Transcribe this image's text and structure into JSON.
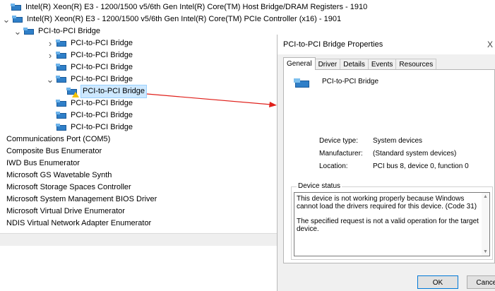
{
  "tree": {
    "items": [
      {
        "label": "Intel(R) Xeon(R) E3 - 1200/1500 v5/6th Gen Intel(R) Core(TM) Host Bridge/DRAM Registers - 1910",
        "indent": 0,
        "chevron": "none",
        "icon": "device"
      },
      {
        "label": "Intel(R) Xeon(R) E3 - 1200/1500 v5/6th Gen Intel(R) Core(TM) PCIe Controller (x16) - 1901",
        "indent": 0,
        "chevron": "down",
        "icon": "device"
      },
      {
        "label": "PCI-to-PCI Bridge",
        "indent": 1,
        "chevron": "down",
        "icon": "device"
      },
      {
        "label": "PCI-to-PCI Bridge",
        "indent": 2,
        "chevron": "right",
        "icon": "device"
      },
      {
        "label": "PCI-to-PCI Bridge",
        "indent": 2,
        "chevron": "right",
        "icon": "device"
      },
      {
        "label": "PCI-to-PCI Bridge",
        "indent": 2,
        "chevron": "none",
        "icon": "device"
      },
      {
        "label": "PCI-to-PCI Bridge",
        "indent": 2,
        "chevron": "down",
        "icon": "device"
      },
      {
        "label": "PCI-to-PCI Bridge",
        "indent": 3,
        "chevron": "none",
        "icon": "warning-device",
        "selected": true
      },
      {
        "label": "PCI-to-PCI Bridge",
        "indent": 2,
        "chevron": "none",
        "icon": "device"
      },
      {
        "label": "PCI-to-PCI Bridge",
        "indent": 2,
        "chevron": "none",
        "icon": "device"
      },
      {
        "label": "PCI-to-PCI Bridge",
        "indent": 2,
        "chevron": "none",
        "icon": "device"
      },
      {
        "label": "Communications Port (COM5)",
        "indent": -1,
        "chevron": "none",
        "icon": "none"
      },
      {
        "label": "Composite Bus Enumerator",
        "indent": -1,
        "chevron": "none",
        "icon": "none"
      },
      {
        "label": "IWD Bus Enumerator",
        "indent": -1,
        "chevron": "none",
        "icon": "none"
      },
      {
        "label": "Microsoft GS Wavetable Synth",
        "indent": -1,
        "chevron": "none",
        "icon": "none"
      },
      {
        "label": "Microsoft Storage Spaces Controller",
        "indent": -1,
        "chevron": "none",
        "icon": "none"
      },
      {
        "label": "Microsoft System Management BIOS Driver",
        "indent": -1,
        "chevron": "none",
        "icon": "none"
      },
      {
        "label": "Microsoft Virtual Drive Enumerator",
        "indent": -1,
        "chevron": "none",
        "icon": "none"
      },
      {
        "label": "NDIS Virtual Network Adapter Enumerator",
        "indent": -1,
        "chevron": "none",
        "icon": "none"
      }
    ]
  },
  "dialog": {
    "title": "PCI-to-PCI Bridge Properties",
    "close_glyph": "X",
    "tabs": [
      "General",
      "Driver",
      "Details",
      "Events",
      "Resources"
    ],
    "active_tab": 0,
    "device_name": "PCI-to-PCI Bridge",
    "properties": [
      {
        "key": "Device type:",
        "value": "System devices"
      },
      {
        "key": "Manufacturer:",
        "value": "(Standard system devices)"
      },
      {
        "key": "Location:",
        "value": "PCI bus 8, device 0, function 0"
      }
    ],
    "status_legend": "Device status",
    "status_lines": [
      "This device is not working properly because Windows cannot load the drivers required for this device. (Code 31)",
      "The specified request is not a valid operation for the target device."
    ],
    "ok_label": "OK",
    "cancel_label": "Cancel"
  },
  "colors": {
    "accent": "#0078d7",
    "selection": "#cde8ff",
    "device_icon": "#2f7fc8",
    "warning": "#f2c200",
    "arrow": "#e0201b"
  }
}
